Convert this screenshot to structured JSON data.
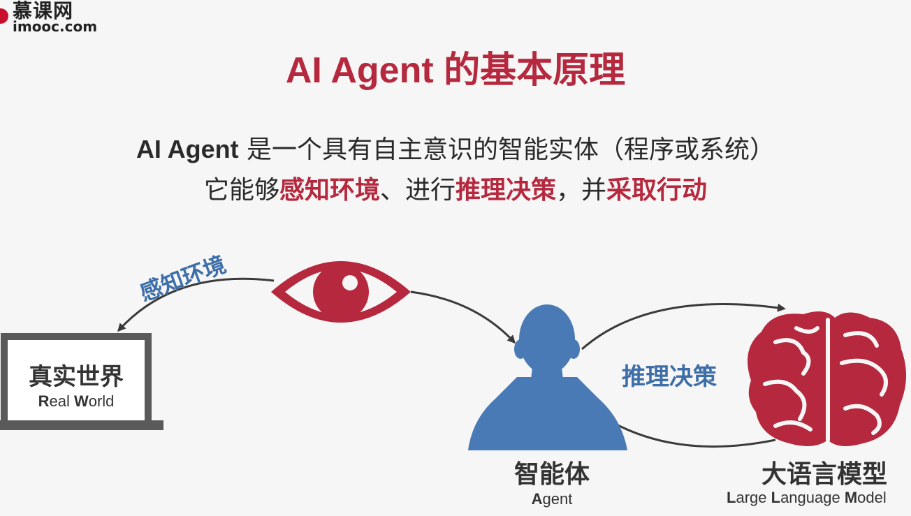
{
  "logo": {
    "cn": "慕课网",
    "en": "imooc.com"
  },
  "title": "AI Agent 的基本原理",
  "subtitle": {
    "line1_strong": "AI Agent",
    "line1_rest": " 是一个具有自主意识的智能实体（程序或系统）",
    "line2_a": "它能够",
    "line2_h1": "感知环境",
    "line2_b": "、进行",
    "line2_h2": "推理决策",
    "line2_c": "，并",
    "line2_h3": "采取行动"
  },
  "diagram": {
    "perceive_label": "感知环境",
    "reason_label": "推理决策",
    "real_world": {
      "cn": "真实世界",
      "en_b1": "R",
      "en_r1": "eal ",
      "en_b2": "W",
      "en_r2": "orld"
    },
    "agent": {
      "cn": "智能体",
      "en_b": "A",
      "en_r": "gent"
    },
    "llm": {
      "cn": "大语言模型",
      "en_b1": "L",
      "en_r1": "arge ",
      "en_b2": "L",
      "en_r2": "anguage ",
      "en_b3": "M",
      "en_r3": "odel"
    }
  },
  "colors": {
    "accent": "#b5283d",
    "blue": "#3d6ea8",
    "eye": "#b5283d",
    "brain": "#b5283d",
    "agent": "#4a7ab5"
  },
  "icons": [
    "eye-icon",
    "monitor-icon",
    "person-icon",
    "brain-icon"
  ]
}
